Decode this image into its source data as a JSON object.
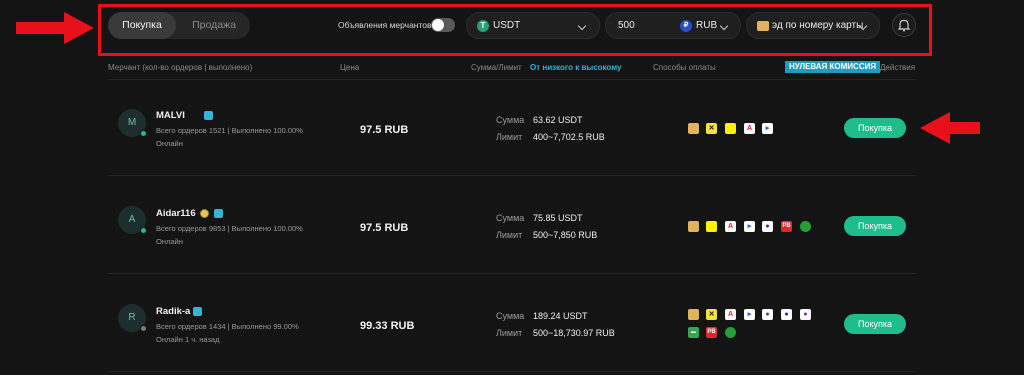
{
  "filters": {
    "tabs": [
      {
        "label": "Покупка"
      },
      {
        "label": "Продажа"
      }
    ],
    "merchant_ads_label": "Объявления мерчантов",
    "merchant_ads_toggle_on": false,
    "crypto": "USDT",
    "amount": "500",
    "fiat": "RUB",
    "payment_method": "эд по номеру карты"
  },
  "table_header": {
    "merchant": "Мерчант (кол-во ордеров | выполнено)",
    "price": "Цена",
    "amount_limit": "Сумма/Лимит",
    "sort": "От низкого к высокому",
    "payment_methods": "Способы оплаты",
    "zero_fee": "НУЛЕВАЯ КОМИССИЯ",
    "actions": "Действия"
  },
  "rows": [
    {
      "initial": "M",
      "name": "MALVI",
      "stats": "Всего ордеров 1521 | Выполнено 100.00%",
      "status": "Онлайн",
      "online": true,
      "price": "97.5 RUB",
      "amount_label": "Сумма",
      "amount": "63.62 USDT",
      "limit_label": "Лимит",
      "limit": "400~7,702.5 RUB",
      "action": "Покупка"
    },
    {
      "initial": "A",
      "name": "Aidar116",
      "stats": "Всего ордеров 9853 | Выполнено 100.00%",
      "status": "Онлайн",
      "online": true,
      "price": "97.5 RUB",
      "amount_label": "Сумма",
      "amount": "75.85 USDT",
      "limit_label": "Лимит",
      "limit": "500~7,850 RUB",
      "action": "Покупка"
    },
    {
      "initial": "R",
      "name": "Radik-a",
      "stats": "Всего ордеров 1434 | Выполнено 99.00%",
      "status": "Онлайн 1 ч. назад",
      "online": false,
      "price": "99.33 RUB",
      "amount_label": "Сумма",
      "amount": "189.24 USDT",
      "limit_label": "Лимит",
      "limit": "500~18,730.97 RUB",
      "action": "Покупка"
    }
  ],
  "colors": {
    "accent_green": "#1fbc8c",
    "accent_cyan": "#2fb6d6",
    "highlight_red": "#e8101a",
    "background": "#141414"
  }
}
